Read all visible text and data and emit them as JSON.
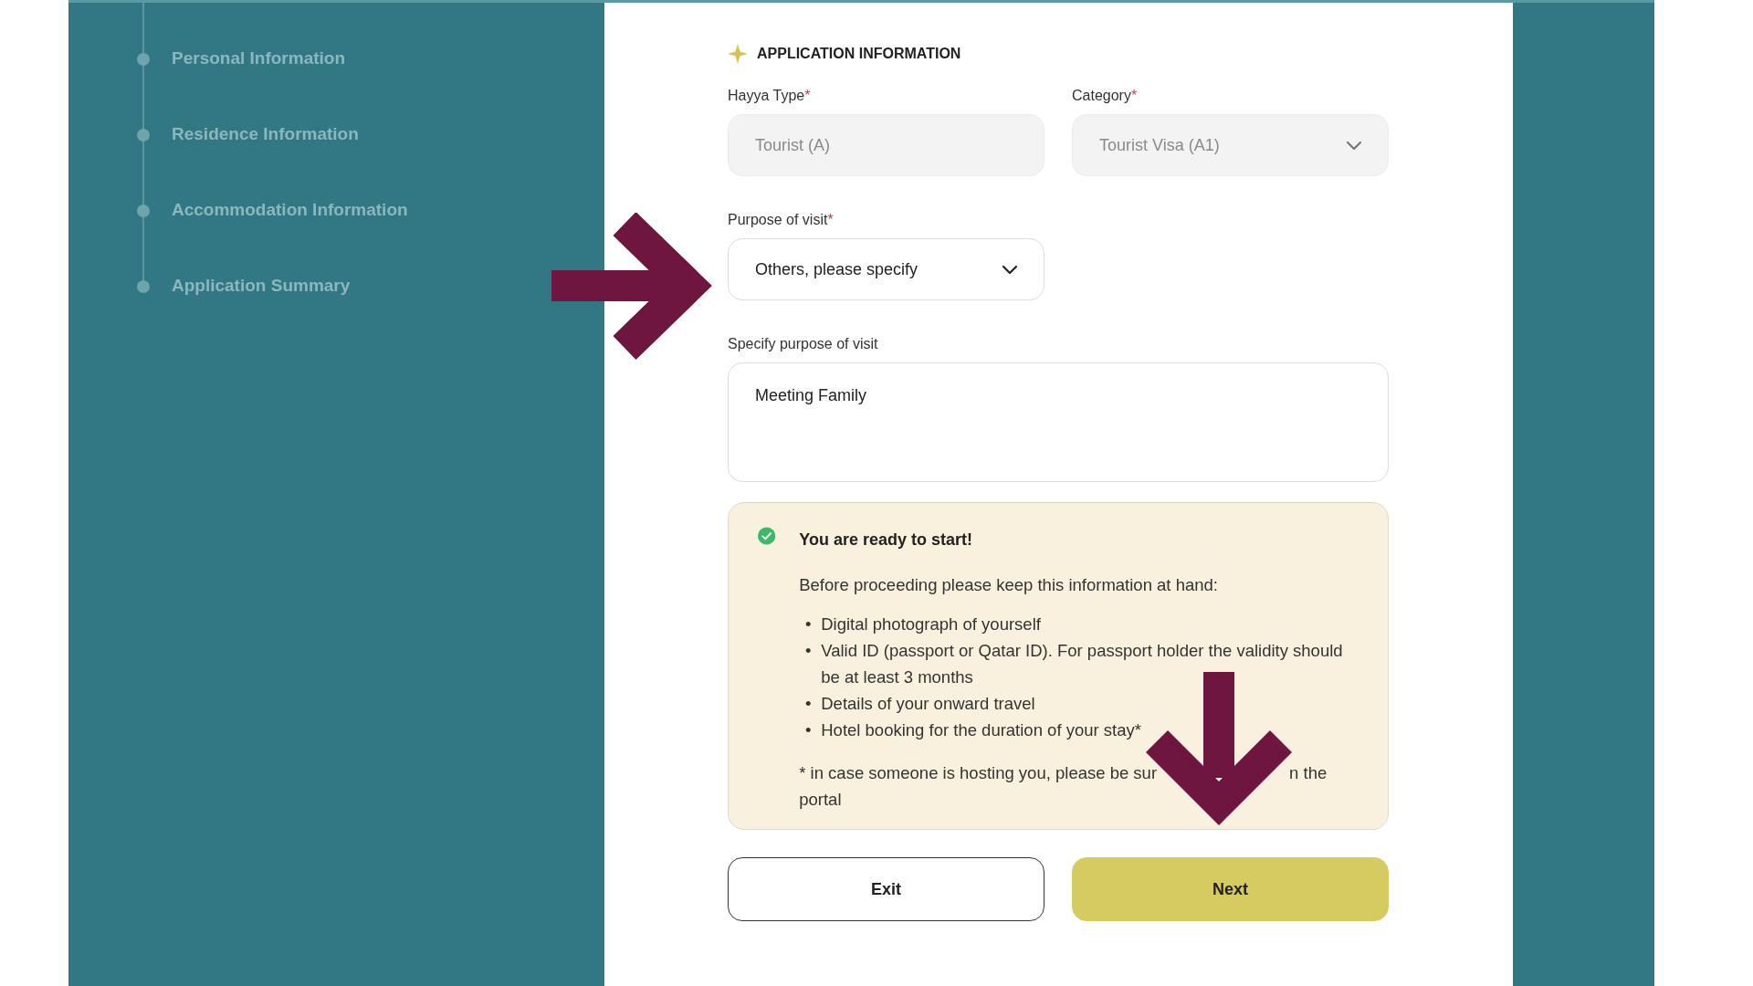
{
  "steps": [
    {
      "label": "Personal Information"
    },
    {
      "label": "Residence Information"
    },
    {
      "label": "Accommodation Information"
    },
    {
      "label": "Application Summary"
    }
  ],
  "section": {
    "title": "APPLICATION INFORMATION"
  },
  "fields": [
    {
      "kind": "text",
      "label": "Hayya Type",
      "mark": "*",
      "value": "Tourist (A)",
      "disabled": true
    },
    {
      "kind": "select",
      "label": "Category",
      "mark": "*",
      "value": "Tourist Visa (A1)",
      "disabled": true
    },
    {
      "kind": "select",
      "label": "Purpose of visit",
      "mark": "*",
      "value": "Others, please specify",
      "disabled": false
    },
    {
      "kind": "textarea",
      "label": "Specify purpose of visit",
      "value": "Meeting Family",
      "disabled": false
    }
  ],
  "notice": {
    "title": "You are ready to start!",
    "intro": "Before proceeding please keep this information at hand:",
    "bullet": "•",
    "items": [
      "Digital photograph of yourself",
      "Valid ID (passport or Qatar ID). For passport holder the validity should be at least 3 months",
      "Details of your onward travel",
      "Hotel booking for the duration of your stay*"
    ],
    "footnote": [
      "* in case someone is hosting you, please be sur",
      "n the",
      "portal"
    ]
  },
  "buttons": [
    {
      "label": "Exit",
      "kind": "outline"
    },
    {
      "label": "Next",
      "kind": "primary"
    }
  ]
}
